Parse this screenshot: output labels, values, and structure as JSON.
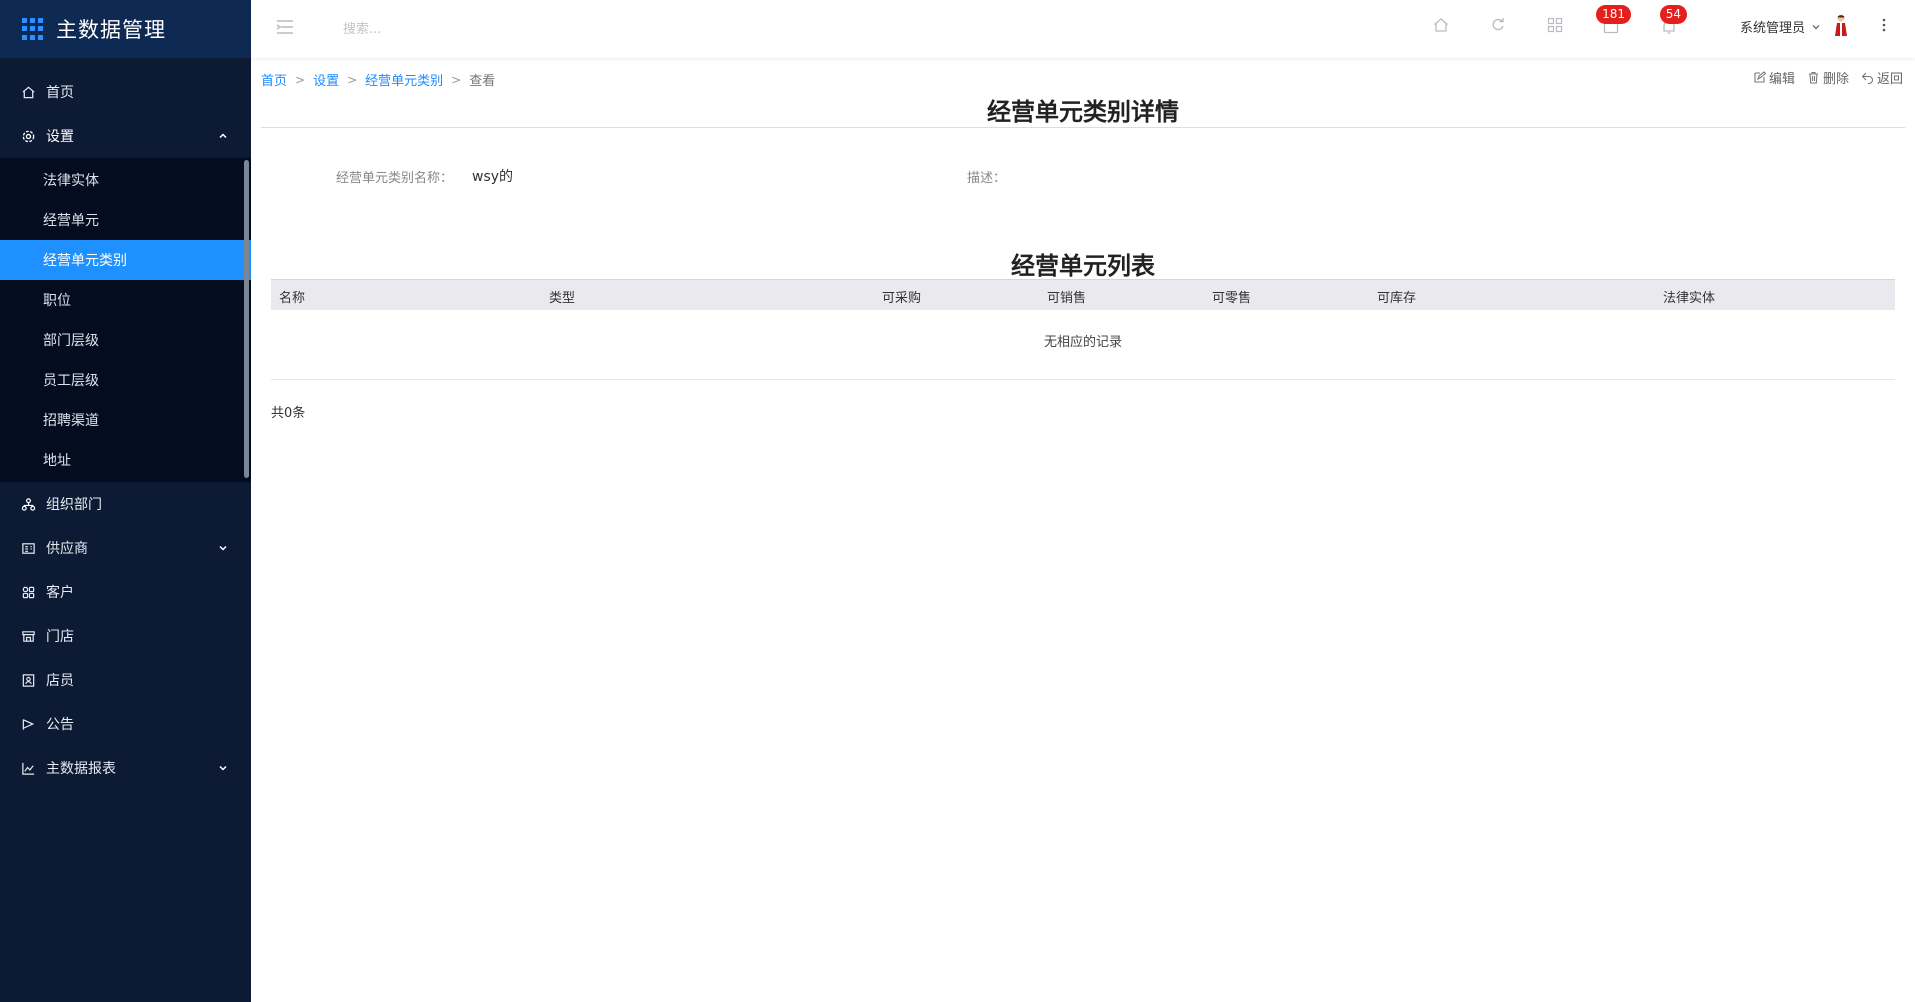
{
  "app": {
    "title": "主数据管理"
  },
  "sidebar": {
    "items": [
      {
        "label": "首页",
        "icon": "home-icon"
      },
      {
        "label": "设置",
        "icon": "gear-icon",
        "open": true
      },
      {
        "label": "组织部门",
        "icon": "org-icon"
      },
      {
        "label": "供应商",
        "icon": "supplier-icon"
      },
      {
        "label": "客户",
        "icon": "customer-icon"
      },
      {
        "label": "门店",
        "icon": "store-icon"
      },
      {
        "label": "店员",
        "icon": "clerk-icon"
      },
      {
        "label": "公告",
        "icon": "notice-icon"
      },
      {
        "label": "主数据报表",
        "icon": "chart-icon"
      }
    ],
    "settings_sub": [
      {
        "label": "法律实体"
      },
      {
        "label": "经营单元"
      },
      {
        "label": "经营单元类别",
        "active": true
      },
      {
        "label": "职位"
      },
      {
        "label": "部门层级"
      },
      {
        "label": "员工层级"
      },
      {
        "label": "招聘渠道"
      },
      {
        "label": "地址"
      }
    ]
  },
  "topbar": {
    "search_placeholder": "搜索...",
    "badge_messages": "181",
    "badge_notifications": "54",
    "user_name": "系统管理员"
  },
  "breadcrumb": {
    "home": "首页",
    "settings": "设置",
    "category": "经营单元类别",
    "current": "查看",
    "sep": ">"
  },
  "actions": {
    "edit": "编辑",
    "delete": "删除",
    "back": "返回"
  },
  "detail": {
    "title": "经营单元类别详情",
    "name_label": "经营单元类别名称：",
    "name_value": "wsy的",
    "desc_label": "描述：",
    "desc_value": ""
  },
  "list": {
    "title": "经营单元列表",
    "columns": [
      "名称",
      "类型",
      "可采购",
      "可销售",
      "可零售",
      "可库存",
      "法律实体"
    ],
    "empty_text": "无相应的记录",
    "total": "共0条"
  },
  "colors": {
    "sidebar_bg": "#0c1a33",
    "active": "#1e90ff",
    "badge": "#e4201c",
    "link": "#1e8bff"
  }
}
